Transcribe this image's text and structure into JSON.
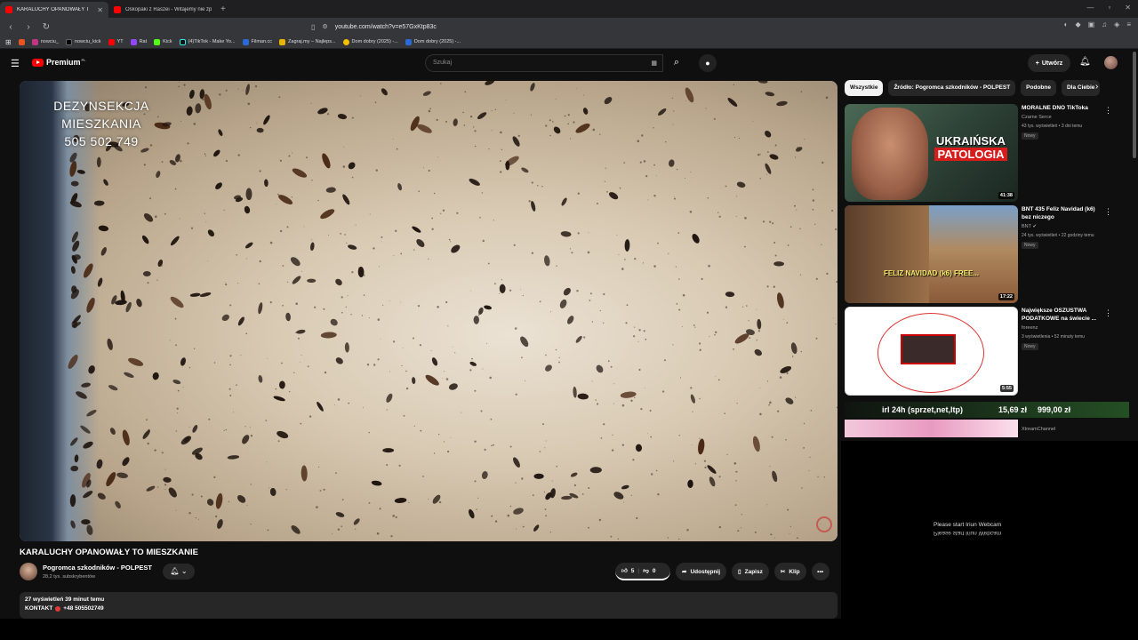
{
  "browser": {
    "tabs": [
      {
        "title": "KARALUCHY OPANOWAŁY T",
        "active": true
      },
      {
        "title": "Ośkopaki z Raszei - Witajemy nie źp",
        "active": false
      }
    ],
    "url": "youtube.com/watch?v=e57GxKtp83c",
    "bookmarks": [
      "nowciu_",
      "nowciu_kick",
      "YT",
      "Rat",
      "Kick",
      "(4)TikTok - Make Yo...",
      "Filman.cc",
      "Zagraj.my – Najleps...",
      "Dom dobry (2025) -...",
      "Dom dobry (2025) -..."
    ]
  },
  "header": {
    "logo": "Premium",
    "logo_region": "PL",
    "search_placeholder": "Szukaj",
    "create_label": "Utwórz"
  },
  "video": {
    "overlay_lines": [
      "DEZYNSEKCJA",
      "MIESZKANIA",
      "505 502 749"
    ],
    "title": "KARALUCHY OPANOWAŁY TO MIESZKANIE",
    "channel": "Pogromca szkodników - POLPEST",
    "subscribers": "28,2 tys. subskrybentów",
    "likes": "5",
    "dislikes": "0",
    "share_label": "Udostępnij",
    "save_label": "Zapisz",
    "clip_label": "Klip",
    "stats": "27 wyświetleń  39 minut temu",
    "contact_label": "KONTAKT",
    "contact_phone": "+48 505502749"
  },
  "chips": [
    "Wszystkie",
    "Źródło: Pogromca szkodników - POLPEST",
    "Podobne",
    "Dla Ciebie"
  ],
  "recommendations": [
    {
      "title": "MORALNE DNO TikToka",
      "channel": "Czarne Serce",
      "meta": "43 tys. wyświetleń • 3 dni temu",
      "badge": "Nowy",
      "duration": "41:38",
      "thumb_line1": "UKRAIŃSKA",
      "thumb_line2": "PATOLOGIA"
    },
    {
      "title": "BNT 435 Feliz Navidad (k6) bez niczego",
      "channel": "BNT",
      "meta": "24 tys. wyświetleń • 22 godziny temu",
      "badge": "Nowy",
      "duration": "17:22",
      "thumb_text": "FELIZ NAVIDAD (k6) FREE..."
    },
    {
      "title": "Największe OSZUSTWA PODATKOWE na świecie ...",
      "channel": "foreenz",
      "meta": "3 wyświetlenia • 52 minuty temu",
      "badge": "Nowy",
      "duration": "5:55"
    },
    {
      "channel": "XtreamChannel"
    }
  ],
  "overlay_bar": {
    "left": "irl 24h (sprzet,net,ltp)",
    "mid": "15,69 zł",
    "right": "999,00 zł"
  },
  "webcam": {
    "line1": "Please start Iriun Webcam",
    "line2": "Please start Iriun Webcam"
  }
}
